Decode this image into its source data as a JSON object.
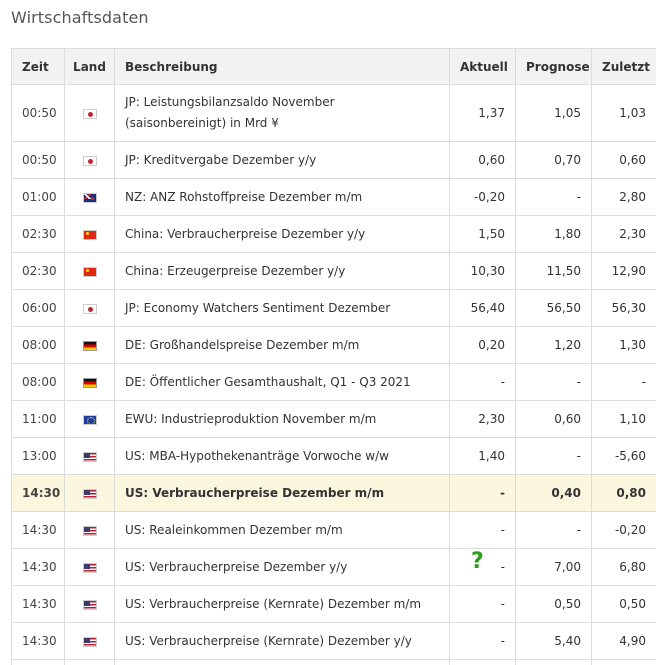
{
  "title": "Wirtschaftsdaten",
  "headers": {
    "zeit": "Zeit",
    "land": "Land",
    "beschreibung": "Beschreibung",
    "aktuell": "Aktuell",
    "prognose": "Prognose",
    "zuletzt": "Zuletzt"
  },
  "rows": [
    {
      "zeit": "00:50",
      "flag": "jp",
      "beschreibung": "JP: Leistungsbilanzsaldo November (saisonbereinigt) in Mrd ¥",
      "aktuell": "1,37",
      "prognose": "1,05",
      "zuletzt": "1,03"
    },
    {
      "zeit": "00:50",
      "flag": "jp",
      "beschreibung": "JP: Kreditvergabe Dezember y/y",
      "aktuell": "0,60",
      "prognose": "0,70",
      "zuletzt": "0,60"
    },
    {
      "zeit": "01:00",
      "flag": "nz",
      "beschreibung": "NZ: ANZ Rohstoffpreise Dezember m/m",
      "aktuell": "-0,20",
      "prognose": "-",
      "zuletzt": "2,80"
    },
    {
      "zeit": "02:30",
      "flag": "cn",
      "beschreibung": "China: Verbraucherpreise Dezember y/y",
      "aktuell": "1,50",
      "prognose": "1,80",
      "zuletzt": "2,30"
    },
    {
      "zeit": "02:30",
      "flag": "cn",
      "beschreibung": "China: Erzeugerpreise Dezember y/y",
      "aktuell": "10,30",
      "prognose": "11,50",
      "zuletzt": "12,90"
    },
    {
      "zeit": "06:00",
      "flag": "jp",
      "beschreibung": "JP: Economy Watchers Sentiment Dezember",
      "aktuell": "56,40",
      "prognose": "56,50",
      "zuletzt": "56,30"
    },
    {
      "zeit": "08:00",
      "flag": "de",
      "beschreibung": "DE: Großhandelspreise Dezember m/m",
      "aktuell": "0,20",
      "prognose": "1,20",
      "zuletzt": "1,30"
    },
    {
      "zeit": "08:00",
      "flag": "de",
      "beschreibung": "DE: Öffentlicher Gesamthaushalt, Q1 - Q3 2021",
      "aktuell": "-",
      "prognose": "-",
      "zuletzt": "-"
    },
    {
      "zeit": "11:00",
      "flag": "eu",
      "beschreibung": "EWU: Industrieproduktion November m/m",
      "aktuell": "2,30",
      "prognose": "0,60",
      "zuletzt": "1,10"
    },
    {
      "zeit": "13:00",
      "flag": "us",
      "beschreibung": "US: MBA-Hypothekenanträge Vorwoche w/w",
      "aktuell": "1,40",
      "prognose": "-",
      "zuletzt": "-5,60"
    },
    {
      "zeit": "14:30",
      "flag": "us",
      "beschreibung": "US: Verbraucherpreise Dezember m/m",
      "aktuell": "-",
      "prognose": "0,40",
      "zuletzt": "0,80",
      "highlight": true
    },
    {
      "zeit": "14:30",
      "flag": "us",
      "beschreibung": "US: Realeinkommen Dezember m/m",
      "aktuell": "-",
      "prognose": "-",
      "zuletzt": "-0,20"
    },
    {
      "zeit": "14:30",
      "flag": "us",
      "beschreibung": "US: Verbraucherpreise Dezember y/y",
      "aktuell": "-",
      "prognose": "7,00",
      "zuletzt": "6,80"
    },
    {
      "zeit": "14:30",
      "flag": "us",
      "beschreibung": "US: Verbraucherpreise (Kernrate) Dezember m/m",
      "aktuell": "-",
      "prognose": "0,50",
      "zuletzt": "0,50"
    },
    {
      "zeit": "14:30",
      "flag": "us",
      "beschreibung": "US: Verbraucherpreise (Kernrate) Dezember y/y",
      "aktuell": "-",
      "prognose": "5,40",
      "zuletzt": "4,90"
    },
    {
      "zeit": "",
      "flag": "",
      "beschreibung": "",
      "aktuell": "",
      "prognose": "",
      "zuletzt": ""
    }
  ],
  "annotation": "?",
  "colors": {
    "highlight": "#fbf7df",
    "header": "#f2f2f2",
    "annotation": "#2e9b1e"
  },
  "flag_icons": {
    "jp": "flag-japan-icon",
    "nz": "flag-new-zealand-icon",
    "cn": "flag-china-icon",
    "de": "flag-germany-icon",
    "eu": "flag-eu-icon",
    "us": "flag-usa-icon"
  }
}
